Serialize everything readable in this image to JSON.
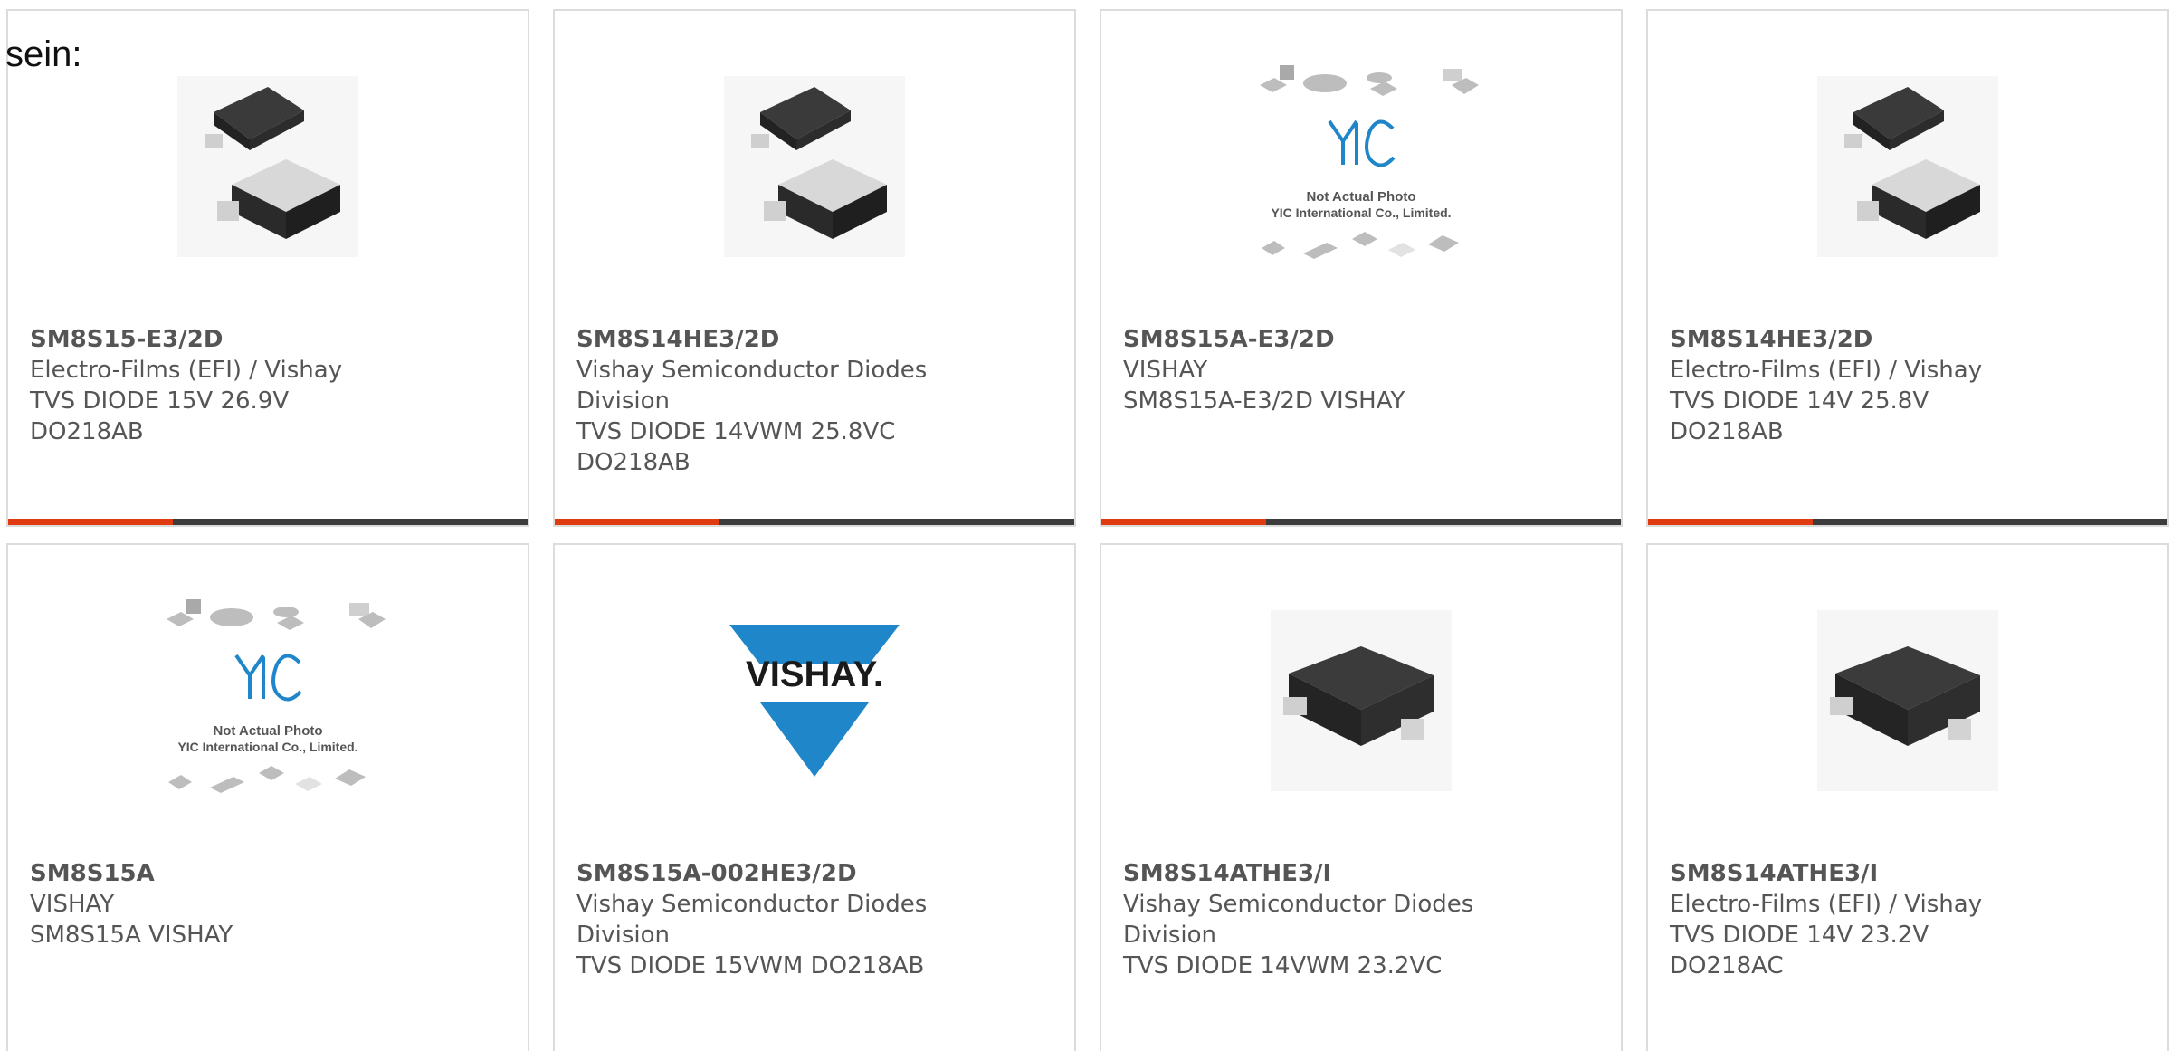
{
  "lead_text": "sein:",
  "colors": {
    "accent": "#e03a10",
    "bar": "#3c3c3c",
    "vishay_blue": "#1f86c9",
    "text": "#555555"
  },
  "cards": [
    {
      "part": "SM8S15-E3/2D",
      "manufacturer": "Electro-Films (EFI) / Vishay",
      "description": "TVS DIODE 15V 26.9V DO218AB",
      "image": "package-do218ab-photo"
    },
    {
      "part": "SM8S14HE3/2D",
      "manufacturer": "Vishay Semiconductor Diodes Division",
      "description": "TVS DIODE 14VWM 25.8VC DO218AB",
      "image": "package-do218ab-photo"
    },
    {
      "part": "SM8S15A-E3/2D",
      "manufacturer": "VISHAY",
      "description": "SM8S15A-E3/2D VISHAY",
      "image": "yic-placeholder",
      "placeholder_line1": "Not Actual Photo",
      "placeholder_line2": "YIC International Co., Limited."
    },
    {
      "part": "SM8S14HE3/2D",
      "manufacturer": "Electro-Films (EFI) / Vishay",
      "description": "TVS DIODE 14V 25.8V DO218AB",
      "image": "package-do218ab-photo"
    },
    {
      "part": "SM8S15A",
      "manufacturer": "VISHAY",
      "description": "SM8S15A VISHAY",
      "image": "yic-placeholder",
      "placeholder_line1": "Not Actual Photo",
      "placeholder_line2": "YIC International Co., Limited."
    },
    {
      "part": "SM8S15A-002HE3/2D",
      "manufacturer": "Vishay Semiconductor Diodes Division",
      "description": "TVS DIODE 15VWM DO218AB",
      "image": "vishay-logo",
      "logo_text": "VISHAY."
    },
    {
      "part": "SM8S14ATHE3/I",
      "manufacturer": "Vishay Semiconductor Diodes Division",
      "description": "TVS DIODE 14VWM 23.2VC",
      "image": "package-do218ac-photo"
    },
    {
      "part": "SM8S14ATHE3/I",
      "manufacturer": "Electro-Films (EFI) / Vishay",
      "description": "TVS DIODE 14V 23.2V DO218AC",
      "image": "package-do218ac-photo"
    }
  ]
}
